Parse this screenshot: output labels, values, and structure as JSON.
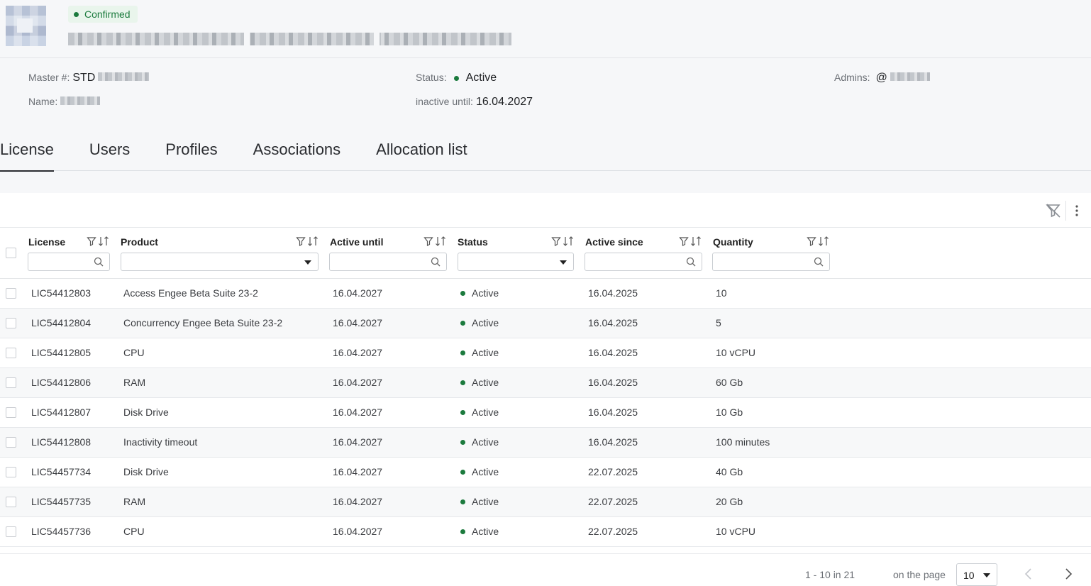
{
  "header": {
    "status_badge": "Confirmed"
  },
  "info": {
    "master_label": "Master #:",
    "master_value": "STD",
    "name_label": "Name:",
    "status_label": "Status:",
    "status_value": "Active",
    "inactive_label": "inactive until:",
    "inactive_value": "16.04.2027",
    "admins_label": "Admins:",
    "admins_value": "@"
  },
  "tabs": [
    {
      "label": "License"
    },
    {
      "label": "Users"
    },
    {
      "label": "Profiles"
    },
    {
      "label": "Associations"
    },
    {
      "label": "Allocation list"
    }
  ],
  "table": {
    "columns": [
      {
        "title": "License"
      },
      {
        "title": "Product"
      },
      {
        "title": "Active until"
      },
      {
        "title": "Status"
      },
      {
        "title": "Active since"
      },
      {
        "title": "Quantity"
      }
    ],
    "rows": [
      {
        "license": "LIC54412803",
        "product": "Access Engee Beta Suite 23-2",
        "until": "16.04.2027",
        "status": "Active",
        "since": "16.04.2025",
        "qty": "10"
      },
      {
        "license": "LIC54412804",
        "product": "Concurrency Engee Beta Suite 23-2",
        "until": "16.04.2027",
        "status": "Active",
        "since": "16.04.2025",
        "qty": "5"
      },
      {
        "license": "LIC54412805",
        "product": "CPU",
        "until": "16.04.2027",
        "status": "Active",
        "since": "16.04.2025",
        "qty": "10 vCPU"
      },
      {
        "license": "LIC54412806",
        "product": "RAM",
        "until": "16.04.2027",
        "status": "Active",
        "since": "16.04.2025",
        "qty": "60 Gb"
      },
      {
        "license": "LIC54412807",
        "product": "Disk Drive",
        "until": "16.04.2027",
        "status": "Active",
        "since": "16.04.2025",
        "qty": "10 Gb"
      },
      {
        "license": "LIC54412808",
        "product": "Inactivity timeout",
        "until": "16.04.2027",
        "status": "Active",
        "since": "16.04.2025",
        "qty": "100 minutes"
      },
      {
        "license": "LIC54457734",
        "product": "Disk Drive",
        "until": "16.04.2027",
        "status": "Active",
        "since": "22.07.2025",
        "qty": "40 Gb"
      },
      {
        "license": "LIC54457735",
        "product": "RAM",
        "until": "16.04.2027",
        "status": "Active",
        "since": "22.07.2025",
        "qty": "20 Gb"
      },
      {
        "license": "LIC54457736",
        "product": "CPU",
        "until": "16.04.2027",
        "status": "Active",
        "since": "22.07.2025",
        "qty": "10 vCPU"
      }
    ]
  },
  "footer": {
    "range": "1 - 10 in 21",
    "per_page_label": "on the page",
    "per_page_value": "10"
  },
  "colors": {
    "active_green": "#1b7a3d",
    "badge_bg": "#e9f5ec"
  }
}
